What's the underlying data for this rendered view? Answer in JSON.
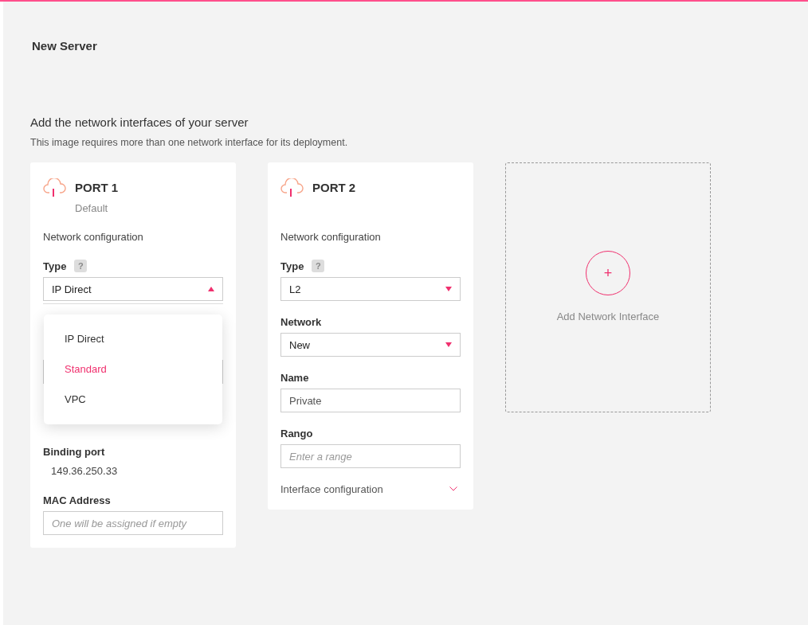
{
  "page": {
    "title": "New Server"
  },
  "section": {
    "heading": "Add the network interfaces of your server",
    "description": "This image requires more than one network interface for its deployment."
  },
  "ports": [
    {
      "title": "PORT 1",
      "subtitle": "Default",
      "config_label": "Network configuration",
      "fields": [
        {
          "kind": "select",
          "label": "Type",
          "help": "?",
          "value": "IP Direct",
          "open": true,
          "options": [
            {
              "label": "IP Direct",
              "highlighted": false
            },
            {
              "label": "Standard",
              "highlighted": true
            },
            {
              "label": "VPC",
              "highlighted": false
            }
          ]
        },
        {
          "kind": "input"
        },
        {
          "kind": "readout"
        },
        {
          "kind": "readout",
          "label": "Binding port",
          "value": "149.36.250.33"
        },
        {
          "kind": "input",
          "label": "MAC Address",
          "placeholder": "One will be assigned if empty"
        }
      ]
    },
    {
      "title": "PORT 2",
      "config_label": "Network configuration",
      "fields": [
        {
          "kind": "select",
          "label": "Type",
          "help": "?",
          "value": "L2",
          "open": false
        },
        {
          "kind": "select",
          "label": "Network",
          "value": "New",
          "open": false
        },
        {
          "kind": "input",
          "label": "Name",
          "value": "Private"
        },
        {
          "kind": "input",
          "label": "Rango",
          "placeholder": "Enter a range"
        }
      ],
      "footer": {
        "label": "Interface configuration",
        "expanded": false
      }
    }
  ],
  "add_card": {
    "label": "Add Network Interface",
    "button": "+"
  }
}
